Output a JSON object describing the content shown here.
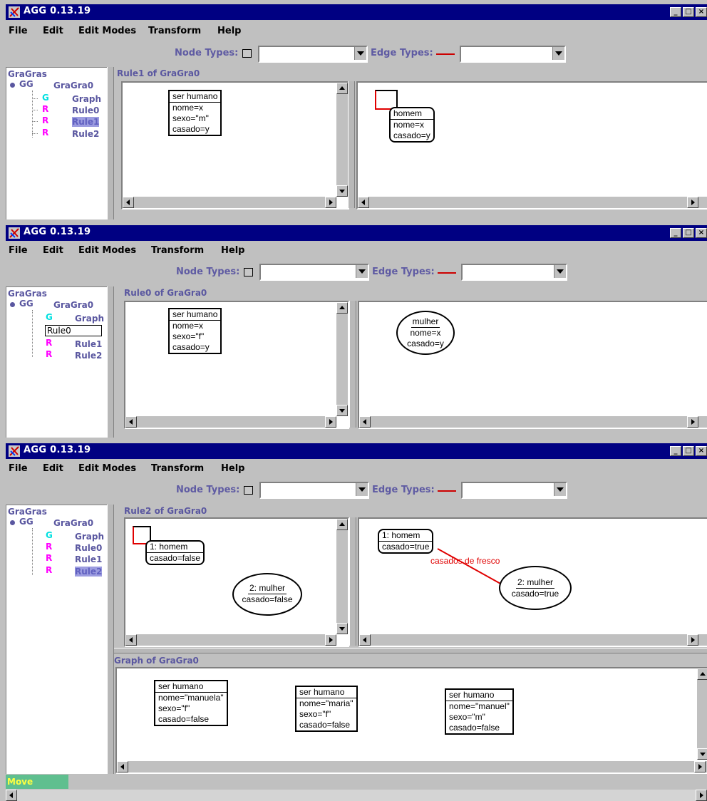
{
  "app": {
    "title": "AGG  0.13.19",
    "menu": [
      "File",
      "Edit",
      "Edit Modes",
      "Transform",
      "Help"
    ],
    "node_types_label": "Node Types:",
    "edge_types_label": "Edge Types:",
    "node_types_value": "",
    "edge_types_value": ""
  },
  "tree": {
    "root": "GraGras",
    "grammar_tag": "GG",
    "grammar_name": "GraGra0",
    "graph_tag": "G",
    "graph_name": "Graph",
    "rule_tag": "R",
    "rules": [
      "Rule0",
      "Rule1",
      "Rule2"
    ]
  },
  "windows": [
    {
      "rule_title": "Rule1  of  GraGra0",
      "lhs": {
        "type": "ser humano",
        "attrs": [
          "nome=x",
          "sexo=\"m\"",
          "casado=y"
        ]
      },
      "rhs": {
        "type": "homem",
        "attrs": [
          "nome=x",
          "casado=y"
        ]
      }
    },
    {
      "rule_title": "Rule0  of  GraGra0",
      "editing_value": "Rule0",
      "lhs": {
        "type": "ser humano",
        "attrs": [
          "nome=x",
          "sexo=\"f\"",
          "casado=y"
        ]
      },
      "rhs": {
        "type": "mulher",
        "attrs": [
          "nome=x",
          "casado=y"
        ]
      }
    },
    {
      "rule_title": "Rule2  of  GraGra0",
      "lhs": {
        "node1": {
          "type": "1:  homem",
          "attrs": [
            "casado=false"
          ]
        },
        "node2": {
          "type": "2:  mulher",
          "attrs": [
            "casado=false"
          ]
        }
      },
      "rhs": {
        "node1": {
          "type": "1:  homem",
          "attrs": [
            "casado=true"
          ]
        },
        "node2": {
          "type": "2:  mulher",
          "attrs": [
            "casado=true"
          ]
        },
        "edge_label": "casados de fresco"
      },
      "graph_title": "Graph  of  GraGra0",
      "graph_nodes": [
        {
          "type": "ser humano",
          "attrs": [
            "nome=\"manuela\"",
            "sexo=\"f\"",
            "casado=false"
          ]
        },
        {
          "type": "ser humano",
          "attrs": [
            "nome=\"maria\"",
            "sexo=\"f\"",
            "casado=false"
          ]
        },
        {
          "type": "ser humano",
          "attrs": [
            "nome=\"manuel\"",
            "sexo=\"m\"",
            "casado=false"
          ]
        }
      ]
    }
  ],
  "status": {
    "mode": "Move"
  },
  "colors": {
    "titlebar": "#000082",
    "edge": "#e00000",
    "tree_text": "#5a57a0",
    "graph_tag": "#00e0e0",
    "rule_tag": "#ff00ff",
    "status_mode_bg": "#5fbf8f",
    "status_mode_text": "#ffff40"
  }
}
